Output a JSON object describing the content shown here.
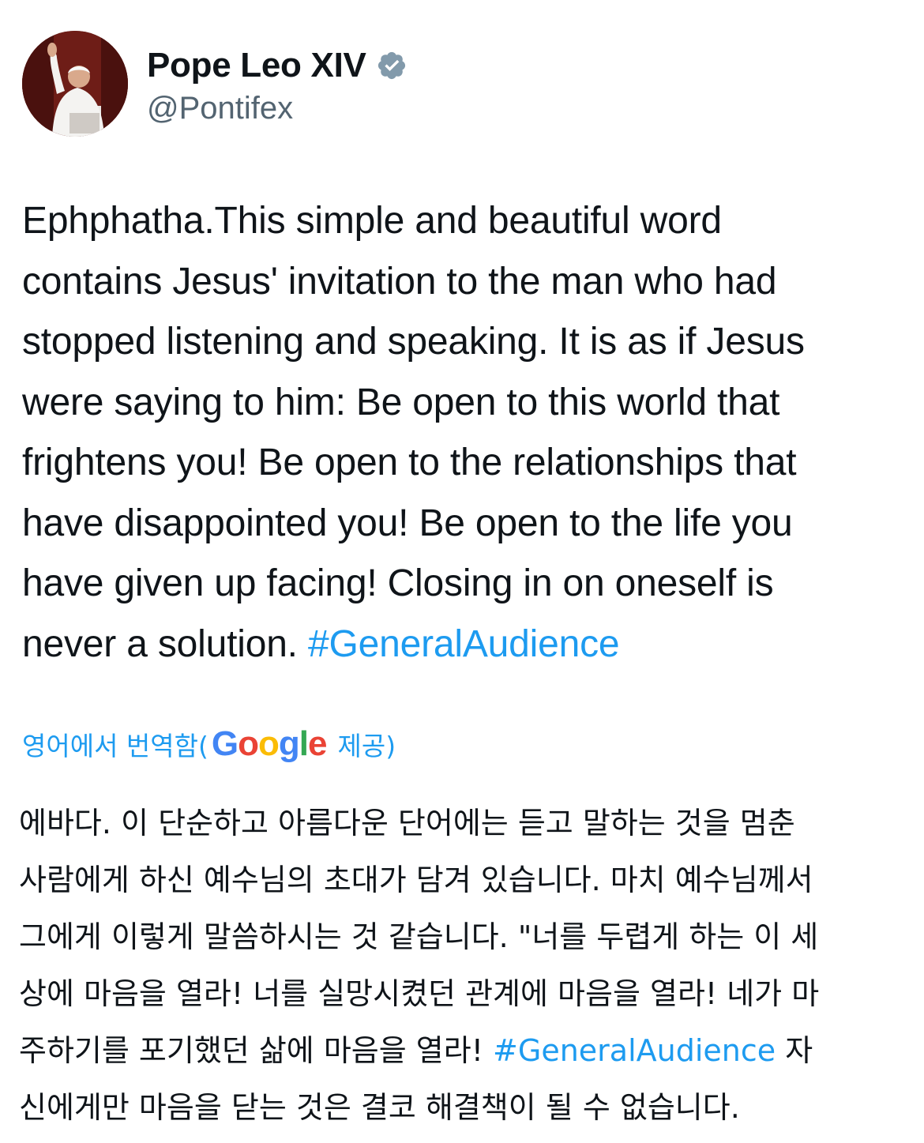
{
  "author": {
    "display_name": "Pope Leo XIV",
    "handle": "@Pontifex",
    "verified_icon": "verified-badge-icon",
    "verified_color": "#829aab"
  },
  "tweet": {
    "lines": [
      "Ephphatha.This simple and beautiful word",
      "contains Jesus' invitation to the man who had",
      "stopped listening and speaking. It is as if Jesus",
      "were saying to him: Be open to this world that",
      "frightens you! Be open to the relationships that",
      "have disappointed you! Be open to the life you",
      "have given up facing! Closing in on oneself is"
    ],
    "last_line_text": "never a solution. ",
    "hashtag": "#GeneralAudience",
    "hashtag_color": "#1d9bf0"
  },
  "translation": {
    "label_prefix": "영어에서 번역함(",
    "google_letters": [
      "G",
      "o",
      "o",
      "g",
      "l",
      "e"
    ],
    "label_suffix": "제공)",
    "lines": [
      "에바다. 이 단순하고 아름다운 단어에는 듣고 말하는 것을 멈춘",
      "사람에게 하신 예수님의 초대가 담겨 있습니다. 마치 예수님께서",
      "그에게 이렇게 말씀하시는 것 같습니다. \"너를 두렵게 하는 이 세",
      "상에 마음을 열라! 너를 실망시켰던 관계에 마음을 열라! 네가 마"
    ],
    "line5_before": "주하기를 포기했던 삶에 마음을 열라! ",
    "line5_hashtag": "#GeneralAudience",
    "line5_after": " 자",
    "line6": "신에게만 마음을 닫는 것은 결코 해결책이 될 수 없습니다."
  }
}
